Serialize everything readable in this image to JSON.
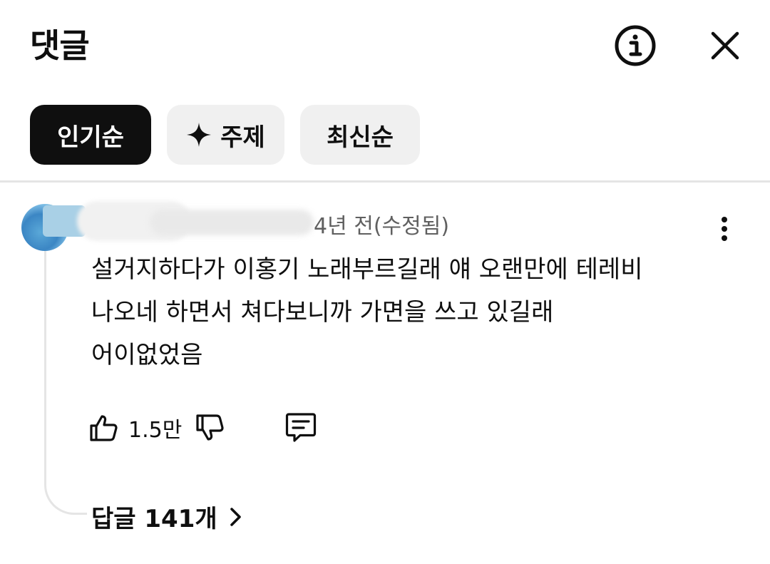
{
  "header": {
    "title": "댓글",
    "info_icon": "info-circle-icon",
    "close_icon": "close-icon"
  },
  "sort_chips": [
    {
      "label": "인기순",
      "active": true
    },
    {
      "label": "주제",
      "icon": "sparkle-icon",
      "active": false
    },
    {
      "label": "최신순",
      "active": false
    }
  ],
  "comment": {
    "meta": "4년 전(수정됨)",
    "lines": [
      "설거지하다가 이홍기 노래부르길래 얘 오랜만에 테레비",
      "나오네 하면서 쳐다보니까 가면을 쓰고 있길래",
      "어이없었음"
    ],
    "like_count": "1.5만",
    "replies_label": "답글 141개"
  },
  "colors": {
    "active_chip_bg": "#0f0f0f",
    "chip_bg": "#f0f0f0",
    "meta_text": "#606060",
    "divider": "#e5e5e5"
  }
}
